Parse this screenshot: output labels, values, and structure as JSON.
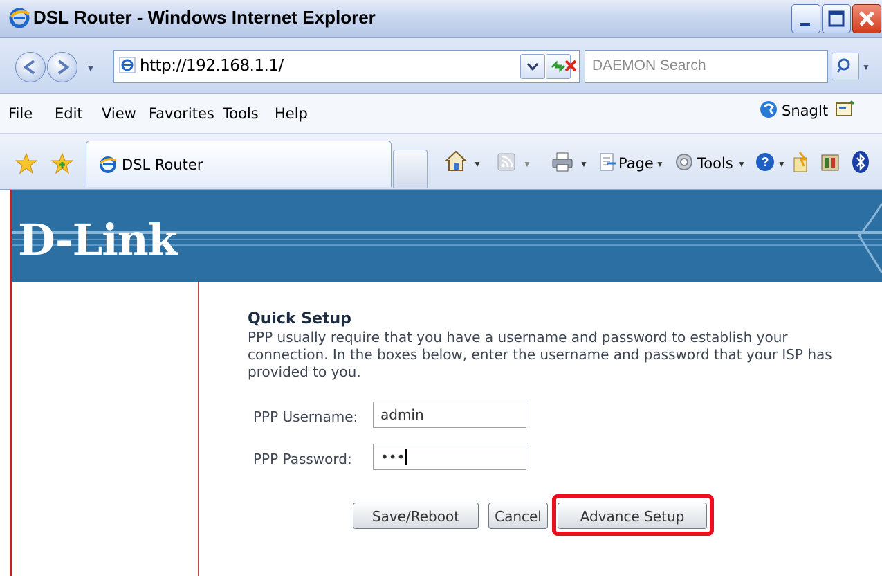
{
  "window": {
    "title": "DSL Router - Windows Internet Explorer",
    "minimize_icon": "minimize-icon",
    "maximize_icon": "maximize-icon",
    "close_icon": "close-icon"
  },
  "navbar": {
    "address": "http://192.168.1.1/",
    "search_placeholder": "DAEMON Search"
  },
  "menu": {
    "items": [
      "File",
      "Edit",
      "View",
      "Favorites",
      "Tools",
      "Help"
    ],
    "snagit_label": "SnagIt"
  },
  "tabbar": {
    "tab_label": "DSL Router",
    "page_label": "Page",
    "tools_label": "Tools"
  },
  "page": {
    "logo": "D-Link",
    "quick_setup": {
      "title": "Quick Setup",
      "description": "PPP usually require that you have a username and password to establish your connection. In the boxes below, enter the username and password that your ISP has provided to you.",
      "username_label": "PPP Username:",
      "username_value": "admin",
      "password_label": "PPP Password:",
      "password_value": "•••"
    },
    "buttons": {
      "save_reboot": "Save/Reboot",
      "cancel": "Cancel",
      "advance_setup": "Advance Setup"
    }
  },
  "colors": {
    "banner": "#2b6fa3",
    "highlight": "#e8101f"
  }
}
